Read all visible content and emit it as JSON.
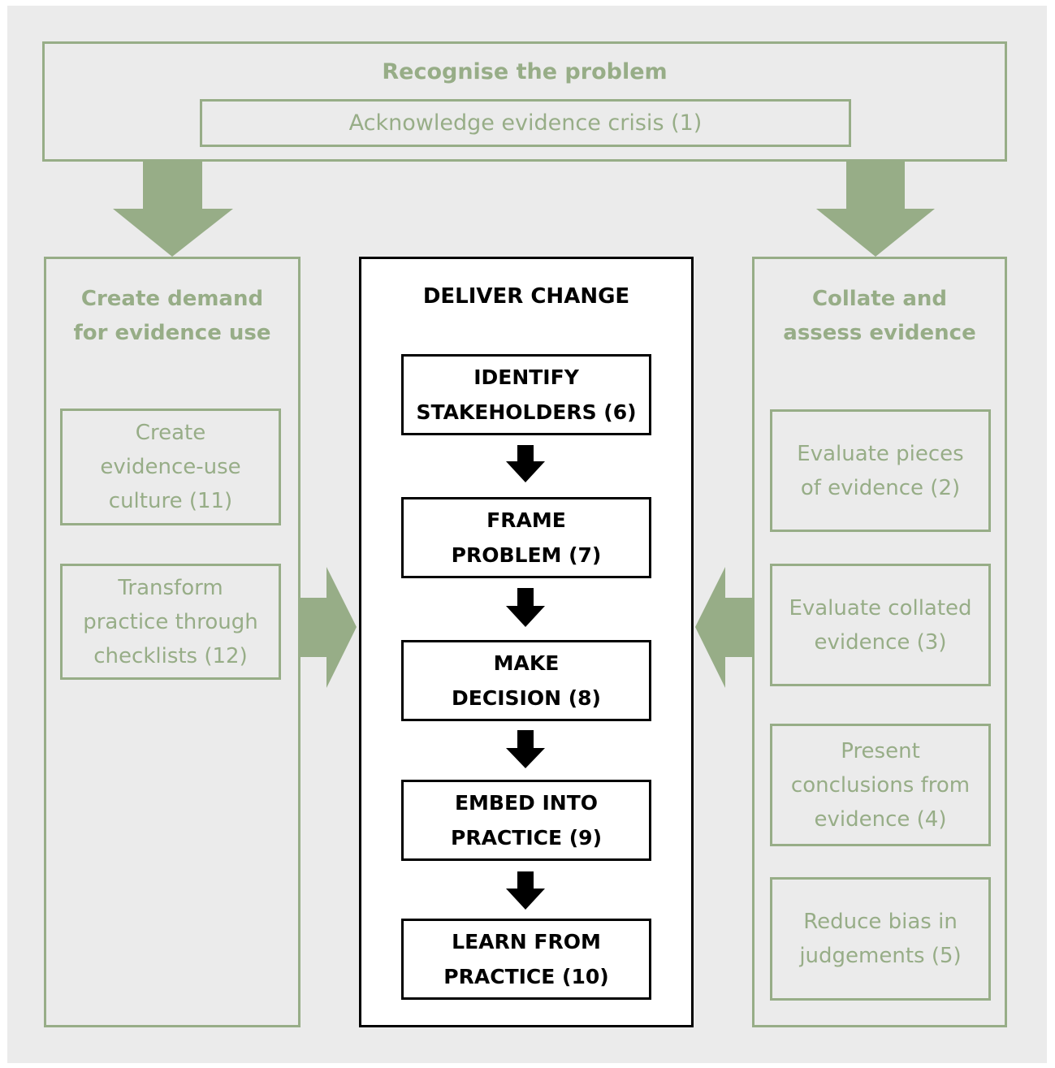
{
  "colors": {
    "accent_green": "#97ad87",
    "background": "#ebebeb",
    "center_border": "#000000"
  },
  "top": {
    "title": "Recognise the problem",
    "item": "Acknowledge evidence crisis (1)"
  },
  "left": {
    "title_line1": "Create demand",
    "title_line2": "for evidence use",
    "items": [
      {
        "line1": "Create",
        "line2": "evidence-use",
        "line3": "culture (11)"
      },
      {
        "line1": "Transform",
        "line2": "practice through",
        "line3": "checklists (12)"
      }
    ]
  },
  "center": {
    "title": "DELIVER CHANGE",
    "steps": [
      {
        "line1": "IDENTIFY",
        "line2": "STAKEHOLDERS (6)"
      },
      {
        "line1": "FRAME",
        "line2": "PROBLEM (7)"
      },
      {
        "line1": "MAKE",
        "line2": "DECISION (8)"
      },
      {
        "line1": "EMBED INTO",
        "line2": "PRACTICE (9)"
      },
      {
        "line1": "LEARN FROM",
        "line2": "PRACTICE (10)"
      }
    ]
  },
  "right": {
    "title_line1": "Collate and",
    "title_line2": "assess evidence",
    "items": [
      {
        "line1": "Evaluate pieces",
        "line2": "of evidence (2)"
      },
      {
        "line1": "Evaluate collated",
        "line2": "evidence (3)"
      },
      {
        "line1": "Present",
        "line2": "conclusions from",
        "line3": "evidence (4)"
      },
      {
        "line1": "Reduce bias in",
        "line2": "judgements (5)"
      }
    ]
  }
}
